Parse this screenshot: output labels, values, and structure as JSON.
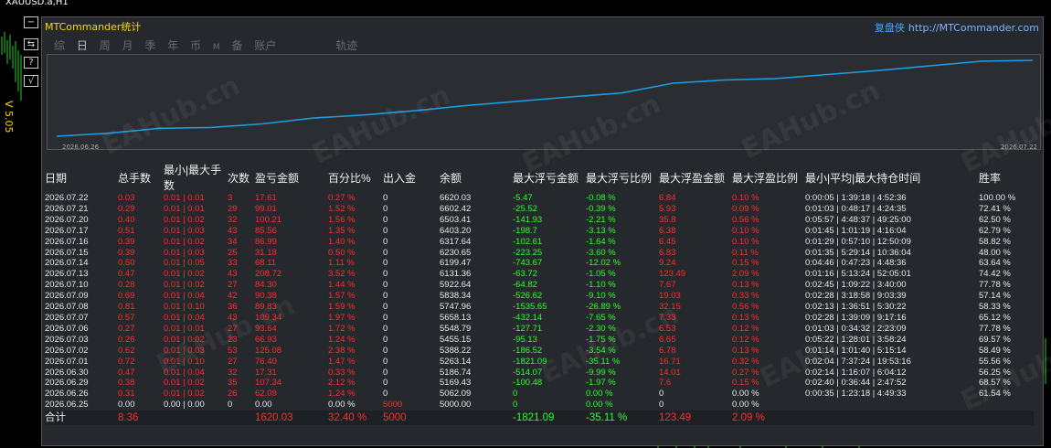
{
  "mt4": {
    "title": "XAUUSD.a,H1"
  },
  "sidebar": {
    "buttons": [
      "−",
      "⇆",
      "?",
      "√"
    ],
    "version": "V 5.05"
  },
  "panel": {
    "title": "MTCommander统计",
    "brand": "复盘侠",
    "url": "http://MTCommander.com",
    "tabs": [
      "综",
      "日",
      "周",
      "月",
      "季",
      "年",
      "币",
      "M",
      "备",
      "账户",
      "轨迹"
    ],
    "active_tab": "日",
    "chart": {
      "start_label": "2026.06.26",
      "end_label": "2026.07.22"
    },
    "watermark": "EAHub.cn"
  },
  "chart_data": {
    "type": "line",
    "x": [
      "2026.06.25",
      "2026.06.26",
      "2026.06.29",
      "2026.06.30",
      "2026.07.01",
      "2026.07.02",
      "2026.07.03",
      "2026.07.06",
      "2026.07.07",
      "2026.07.08",
      "2026.07.09",
      "2026.07.10",
      "2026.07.13",
      "2026.07.14",
      "2026.07.15",
      "2026.07.16",
      "2026.07.17",
      "2026.07.20",
      "2026.07.21",
      "2026.07.22"
    ],
    "values": [
      5000.0,
      5062.09,
      5169.43,
      5186.74,
      5263.14,
      5388.22,
      5455.15,
      5548.79,
      5658.13,
      5747.96,
      5838.34,
      5922.64,
      6131.36,
      6199.47,
      6230.65,
      6317.64,
      6403.2,
      6503.41,
      6602.42,
      6620.03
    ],
    "color": "#1e9be0"
  },
  "table": {
    "headers": [
      "日期",
      "总手数",
      "最小|最大手数",
      "次数",
      "盈亏金额",
      "百分比%",
      "出入金",
      "余额",
      "最大浮亏金额",
      "最大浮亏比例",
      "最大浮盈金额",
      "最大浮盈比例",
      "最小|平均|最大持仓时间",
      "胜率"
    ],
    "rows": [
      [
        "2026.07.22",
        "0.03",
        "0.01 | 0.01",
        "3",
        "17.61",
        "0.27 %",
        "0",
        "6620.03",
        "-5.47",
        "-0.08 %",
        "6.84",
        "0.10 %",
        "0:00:05 | 1:39:18 | 4:52:36",
        "100.00 %"
      ],
      [
        "2026.07.21",
        "0.29",
        "0.01 | 0.01",
        "29",
        "99.01",
        "1.52 %",
        "0",
        "6602.42",
        "-25.52",
        "-0.39 %",
        "5.93",
        "0.09 %",
        "0:01:03 | 0:48:17 | 4:24:35",
        "72.41 %"
      ],
      [
        "2026.07.20",
        "0.40",
        "0.01 | 0.02",
        "32",
        "100.21",
        "1.56 %",
        "0",
        "6503.41",
        "-141.93",
        "-2.21 %",
        "35.8",
        "0.56 %",
        "0:05:57 | 4:48:37 | 49:25:00",
        "62.50 %"
      ],
      [
        "2026.07.17",
        "0.51",
        "0.01 | 0.03",
        "43",
        "85.56",
        "1.35 %",
        "0",
        "6403.20",
        "-198.7",
        "-3.13 %",
        "6.38",
        "0.10 %",
        "0:01:45 | 1:01:19 | 4:16:04",
        "62.79 %"
      ],
      [
        "2026.07.16",
        "0.39",
        "0.01 | 0.02",
        "34",
        "86.99",
        "1.40 %",
        "0",
        "6317.64",
        "-102.61",
        "-1.64 %",
        "6.45",
        "0.10 %",
        "0:01:29 | 0:57:10 | 12:50:09",
        "58.82 %"
      ],
      [
        "2026.07.15",
        "0.39",
        "0.01 | 0.03",
        "25",
        "31.18",
        "0.50 %",
        "0",
        "6230.65",
        "-223.25",
        "-3.60 %",
        "6.83",
        "0.11 %",
        "0:01:35 | 5:29:14 | 10:36:04",
        "48.00 %"
      ],
      [
        "2026.07.14",
        "0.50",
        "0.01 | 0.05",
        "33",
        "68.11",
        "1.11 %",
        "0",
        "6199.47",
        "-743.67",
        "-12.02 %",
        "9.24",
        "0.15 %",
        "0:04:46 | 0:47:23 | 4:48:36",
        "63.64 %"
      ],
      [
        "2026.07.13",
        "0.47",
        "0.01 | 0.02",
        "43",
        "208.72",
        "3.52 %",
        "0",
        "6131.36",
        "-63.72",
        "-1.05 %",
        "123.49",
        "2.09 %",
        "0:01:16 | 5:13:24 | 52:05:01",
        "74.42 %"
      ],
      [
        "2026.07.10",
        "0.28",
        "0.01 | 0.02",
        "27",
        "84.30",
        "1.44 %",
        "0",
        "5922.64",
        "-64.82",
        "-1.10 %",
        "7.67",
        "0.13 %",
        "0:02:45 | 1:09:22 | 3:40:00",
        "77.78 %"
      ],
      [
        "2026.07.09",
        "0.69",
        "0.01 | 0.04",
        "42",
        "90.38",
        "1.57 %",
        "0",
        "5838.34",
        "-526.62",
        "-9.10 %",
        "19.03",
        "0.33 %",
        "0:02:28 | 3:18:58 | 9:03:39",
        "57.14 %"
      ],
      [
        "2026.07.08",
        "0.81",
        "0.01 | 0.10",
        "36",
        "89.83",
        "1.59 %",
        "0",
        "5747.96",
        "-1535.65",
        "-26.89 %",
        "32.15",
        "0.56 %",
        "0:02:13 | 1:36:51 | 5:30:22",
        "58.33 %"
      ],
      [
        "2026.07.07",
        "0.57",
        "0.01 | 0.04",
        "43",
        "109.34",
        "1.97 %",
        "0",
        "5658.13",
        "-432.14",
        "-7.65 %",
        "7.33",
        "0.13 %",
        "0:02:28 | 1:39:09 | 9:17:16",
        "65.12 %"
      ],
      [
        "2026.07.06",
        "0.27",
        "0.01 | 0.01",
        "27",
        "93.64",
        "1.72 %",
        "0",
        "5548.79",
        "-127.71",
        "-2.30 %",
        "6.53",
        "0.12 %",
        "0:01:03 | 0:34:32 | 2:23:09",
        "77.78 %"
      ],
      [
        "2026.07.03",
        "0.26",
        "0.01 | 0.02",
        "23",
        "66.93",
        "1.24 %",
        "0",
        "5455.15",
        "-95.13",
        "-1.75 %",
        "6.65",
        "0.12 %",
        "0:05:22 | 1:28:01 | 3:58:24",
        "69.57 %"
      ],
      [
        "2026.07.02",
        "0.62",
        "0.01 | 0.03",
        "53",
        "125.08",
        "2.38 %",
        "0",
        "5388.22",
        "-186.52",
        "-3.54 %",
        "6.78",
        "0.13 %",
        "0:01:14 | 1:01:40 | 5:15:14",
        "58.49 %"
      ],
      [
        "2026.07.01",
        "0.72",
        "0.01 | 0.10",
        "27",
        "76.40",
        "1.47 %",
        "0",
        "5263.14",
        "-1821.09",
        "-35.11 %",
        "16.71",
        "0.32 %",
        "0:02:04 | 7:37:24 | 19:53:16",
        "55.56 %"
      ],
      [
        "2026.06.30",
        "0.47",
        "0.01 | 0.04",
        "32",
        "17.31",
        "0.33 %",
        "0",
        "5186.74",
        "-514.07",
        "-9.99 %",
        "14.01",
        "0.27 %",
        "0:02:14 | 1:16:07 | 6:04:12",
        "56.25 %"
      ],
      [
        "2026.06.29",
        "0.38",
        "0.01 | 0.02",
        "35",
        "107.34",
        "2.12 %",
        "0",
        "5169.43",
        "-100.48",
        "-1.97 %",
        "7.6",
        "0.15 %",
        "0:02:40 | 0:36:44 | 2:47:52",
        "68.57 %"
      ],
      [
        "2026.06.26",
        "0.31",
        "0.01 | 0.02",
        "26",
        "62.09",
        "1.24 %",
        "0",
        "5062.09",
        "0",
        "0.00 %",
        "0",
        "0.00 %",
        "0:00:35 | 1:23:18 | 4:49:33",
        "61.54 %"
      ],
      [
        "2026.06.25",
        "0.00",
        "0.00 | 0.00",
        "0",
        "0.00",
        "0.00 %",
        "5000",
        "5000.00",
        "0",
        "0.00 %",
        "0",
        "0.00 %",
        "",
        ""
      ]
    ],
    "total": [
      "合计",
      "8.36",
      "",
      "",
      "1620.03",
      "32.40 %",
      "5000",
      "",
      "-1821.09",
      "-35.11 %",
      "123.49",
      "2.09 %",
      "",
      ""
    ]
  }
}
